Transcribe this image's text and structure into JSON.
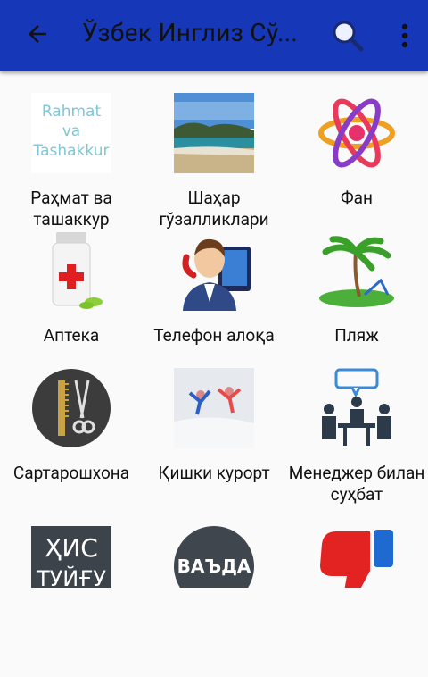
{
  "appbar": {
    "title": "Ўзбек Инглиз Сў...",
    "back_icon": "arrow-left-icon",
    "search_icon": "search-icon",
    "more_icon": "more-vertical-icon",
    "color": "#1638b8"
  },
  "tiles": [
    {
      "label": "Раҳмат ва ташаккур",
      "img_text_1": "Rahmat",
      "img_text_2": "va",
      "img_text_3": "Tashakkur"
    },
    {
      "label": "Шаҳар гўзалликлари"
    },
    {
      "label": "Фан"
    },
    {
      "label": "Аптека"
    },
    {
      "label": "Телефон алоқа"
    },
    {
      "label": "Пляж"
    },
    {
      "label": "Сартарошхона"
    },
    {
      "label": "Қишки курорт"
    },
    {
      "label": "Менеджер билан суҳбат"
    },
    {
      "label": "",
      "img_text_1": "ҲИС",
      "img_text_2": "ТУЙҒУ"
    },
    {
      "label": "",
      "img_text_1": "ВАЪДА"
    },
    {
      "label": ""
    }
  ]
}
